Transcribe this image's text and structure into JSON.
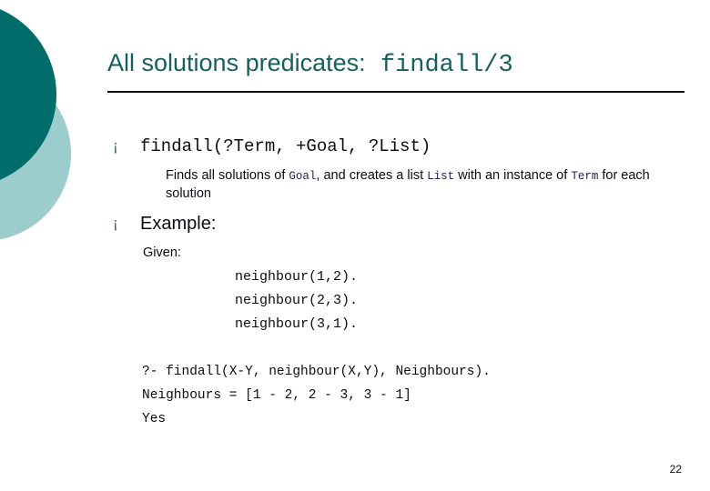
{
  "slide": {
    "page_number": "22",
    "colors": {
      "circle_dark": "#016d6a",
      "circle_light": "#9ccccc",
      "title": "#15605e",
      "rule": "#0b0b16",
      "bullet_marker": "#3c5a63",
      "mono_term": "#1f1f4e",
      "body_text": "#0b0b16"
    }
  },
  "title": {
    "main": "All solutions predicates:",
    "mono": " findall/3"
  },
  "bullets": [
    {
      "marker": "¡",
      "signature": "findall(?Term, +Goal, ?List)"
    },
    {
      "marker": "¡",
      "label": "Example:"
    }
  ],
  "description": {
    "part1": "Finds all solutions of ",
    "term1": "Goal",
    "part2": ", and creates a list ",
    "term2": "List",
    "part3": " with an instance of ",
    "term3": "Term",
    "part4": " for each solution"
  },
  "example": {
    "given_label": "Given:",
    "facts": [
      "neighbour(1,2).",
      "neighbour(2,3).",
      "neighbour(3,1)."
    ],
    "query_lines": [
      "?- findall(X-Y, neighbour(X,Y), Neighbours).",
      "Neighbours = [1 - 2, 2 - 3, 3 - 1]",
      "Yes"
    ]
  }
}
